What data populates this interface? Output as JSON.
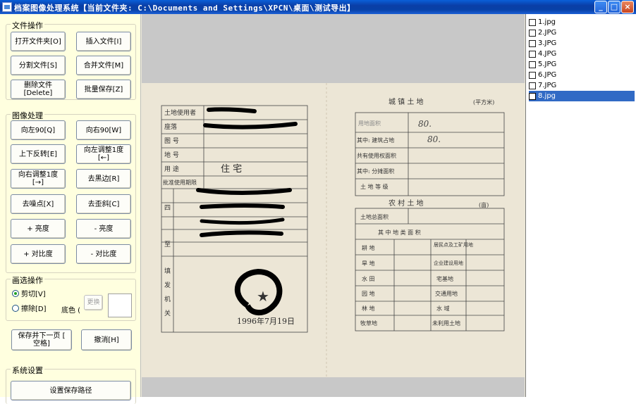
{
  "window": {
    "title": "档案图像处理系统【当前文件夹: C:\\Documents and Settings\\XPCN\\桌面\\测试导出】",
    "controls": {
      "minimize": "_",
      "maximize": "□",
      "close": "×"
    }
  },
  "file_ops": {
    "legend": "文件操作",
    "open_folder": "打开文件夹[O]",
    "insert_file": "插入文件[I]",
    "split_file": "分割文件[S]",
    "merge_file": "合并文件[M]",
    "delete_file_line1": "删除文件",
    "delete_file_line2": "[Delete]",
    "batch_save": "批量保存[Z]"
  },
  "image_ops": {
    "legend": "图像处理",
    "rotate_left": "向左90[Q]",
    "rotate_right": "向右90[W]",
    "flip_vertical": "上下反转[E]",
    "adjust_left_line1": "向左调整1度",
    "adjust_left_line2": "[←]",
    "adjust_right_line1": "向右调整1度",
    "adjust_right_line2": "[→]",
    "remove_black_edge": "去黑边[R]",
    "denoise": "去噪点[X]",
    "deskew": "去歪斜[C]",
    "brightness_up": "+ 亮度",
    "brightness_down": "- 亮度",
    "contrast_up": "+ 对比度",
    "contrast_down": "- 对比度"
  },
  "selection_ops": {
    "legend": "画选操作",
    "cut_label": "剪切[V]",
    "erase_label": "擦除[D]",
    "bg_color_label": "底色 (",
    "change_button": "更换"
  },
  "actions": {
    "save_next_line1": "保存并下一页  [",
    "save_next_line2": "空格]",
    "undo": "撤消[H]"
  },
  "system": {
    "legend": "系统设置",
    "set_save_path": "设置保存路径"
  },
  "files": [
    {
      "name": "1.jpg",
      "selected": false
    },
    {
      "name": "2.JPG",
      "selected": false
    },
    {
      "name": "3.JPG",
      "selected": false
    },
    {
      "name": "4.JPG",
      "selected": false
    },
    {
      "name": "5.JPG",
      "selected": false
    },
    {
      "name": "6.JPG",
      "selected": false
    },
    {
      "name": "7.JPG",
      "selected": false
    },
    {
      "name": "8.jpg",
      "selected": true
    }
  ],
  "document": {
    "left": {
      "land_user": "土地使用者",
      "location": "座落",
      "map_no": "图    号",
      "lot_no": "地    号",
      "usage": "用    途",
      "usage_value": "住  宅",
      "approved_period": "批准使用期限",
      "boundary": "四",
      "to": "至",
      "issuing": "填",
      "issuing2": "发",
      "issuing3": "机",
      "issuing4": "关",
      "date_handwritten": "1996年7月19日"
    },
    "right": {
      "urban_header": "城    镇    土    地",
      "unit_sqm": "(平方米)",
      "land_area": "用地面积",
      "building_area": "其中: 建筑占地",
      "shared_area": "共有使用权面积",
      "apportioned_area": "其中: 分摊面积",
      "land_grade": "土 地 等 级",
      "area_value_1": "80.",
      "area_value_2": "80.",
      "rural_header": "农    村    土    地",
      "unit_mu": "(亩)",
      "total_area": "土地总面积",
      "categories_header": "其    中    地    类    面    积",
      "cultivated": "耕    地",
      "dry_land": "旱  地",
      "paddy": "水  田",
      "garden": "园    地",
      "forest": "林    地",
      "pasture": "牧草地",
      "residential": "居民点及工矿用地",
      "enterprise": "企业建设用地",
      "homestead": "宅基地",
      "transport": "交通用地",
      "water": "水    域",
      "unused": "未利用土地",
      "qi": "其",
      "zhong": "中"
    }
  }
}
